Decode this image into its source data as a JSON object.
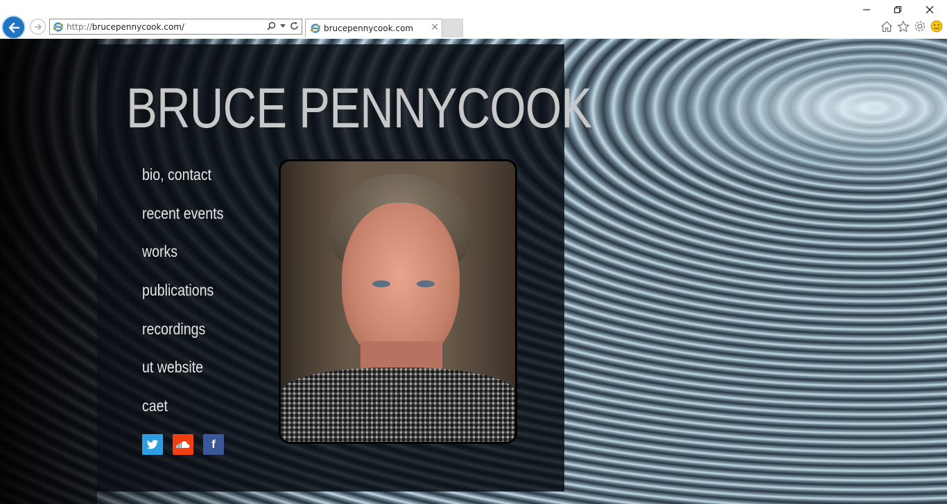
{
  "browser": {
    "url_protocol": "http://",
    "url_host": "brucepennycook.com/",
    "tab_title": "brucepennycook.com",
    "tab_close": "×",
    "window_controls": [
      "minimize",
      "restore",
      "close"
    ],
    "toolbar_icons": [
      "home-icon",
      "favorites-star-icon",
      "settings-gear-icon",
      "feedback-smiley-icon"
    ]
  },
  "site": {
    "title": "BRUCE PENNYCOOK",
    "nav": [
      "bio, contact",
      "recent events",
      "works",
      "publications",
      "recordings",
      "ut website",
      "caet"
    ],
    "social": [
      {
        "name": "twitter",
        "color": "#2e9ee0"
      },
      {
        "name": "soundcloud",
        "color": "#f13f0f"
      },
      {
        "name": "facebook",
        "color": "#3a5897",
        "glyph": "f"
      }
    ]
  },
  "colors": {
    "ie_blue": "#1f74c4",
    "title_gray": "#c8c8c8",
    "nav_text": "#e6e6e6"
  }
}
